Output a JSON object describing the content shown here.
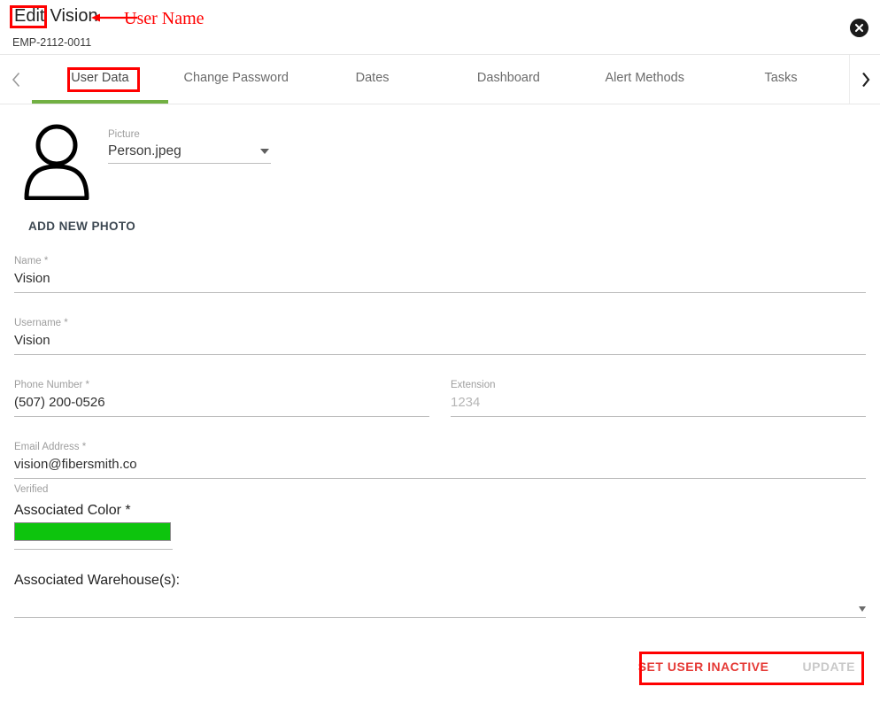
{
  "header": {
    "title_prefix": "Edit",
    "title_name": "Vision",
    "subtitle": "EMP-2112-0011",
    "close_icon": "close-circle-icon"
  },
  "annotations": {
    "user_name_label": "User Name",
    "color": "#ff0000"
  },
  "tabs": {
    "prev_icon": "chevron-left-icon",
    "next_icon": "chevron-right-icon",
    "active_index": 0,
    "items": [
      {
        "label": "User Data"
      },
      {
        "label": "Change Password"
      },
      {
        "label": "Dates"
      },
      {
        "label": "Dashboard"
      },
      {
        "label": "Alert Methods"
      },
      {
        "label": "Tasks"
      }
    ],
    "active_underline_color": "#72b043"
  },
  "form": {
    "avatar_icon": "person-avatar-icon",
    "picture": {
      "label": "Picture",
      "value": "Person.jpeg",
      "dropdown_icon": "chevron-down-icon"
    },
    "add_photo_label": "ADD NEW PHOTO",
    "name": {
      "label": "Name *",
      "value": "Vision"
    },
    "username": {
      "label": "Username *",
      "value": "Vision"
    },
    "phone": {
      "label": "Phone Number *",
      "value": "(507) 200-0526"
    },
    "extension": {
      "label": "Extension",
      "placeholder": "1234"
    },
    "email": {
      "label": "Email Address *",
      "value": "vision@fibersmith.co"
    },
    "verified_label": "Verified",
    "color": {
      "label": "Associated Color *",
      "value": "#0dc40d"
    },
    "warehouses": {
      "label": "Associated Warehouse(s):",
      "value": "",
      "dropdown_icon": "chevron-down-icon"
    }
  },
  "footer": {
    "set_inactive_label": "SET USER INACTIVE",
    "update_label": "UPDATE",
    "set_inactive_color": "#e53935",
    "update_color": "#c9c9c9"
  }
}
